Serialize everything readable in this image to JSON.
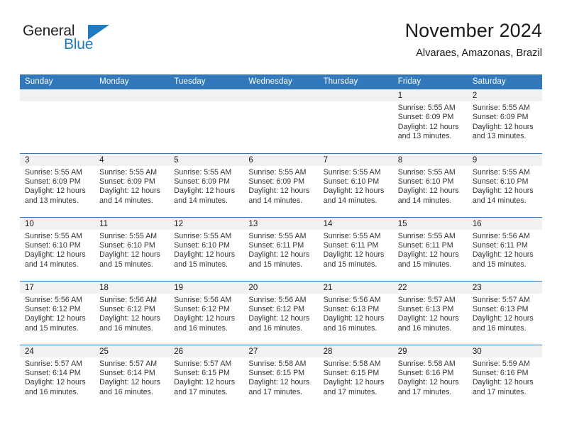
{
  "brand": {
    "name_part1": "General",
    "name_part2": "Blue",
    "triangle_icon": "blue-triangle-icon",
    "accent_color": "#1f7bc1"
  },
  "header": {
    "month_title": "November 2024",
    "location": "Alvaraes, Amazonas, Brazil"
  },
  "theme": {
    "header_blue": "#3279bb",
    "daynum_band": "#f1f1f1",
    "text": "#333333"
  },
  "weekday_headers": [
    "Sunday",
    "Monday",
    "Tuesday",
    "Wednesday",
    "Thursday",
    "Friday",
    "Saturday"
  ],
  "weeks": [
    [
      {
        "day": "",
        "sunrise": "",
        "sunset": "",
        "daylight_line1": "",
        "daylight_line2": "",
        "empty": true
      },
      {
        "day": "",
        "sunrise": "",
        "sunset": "",
        "daylight_line1": "",
        "daylight_line2": "",
        "empty": true
      },
      {
        "day": "",
        "sunrise": "",
        "sunset": "",
        "daylight_line1": "",
        "daylight_line2": "",
        "empty": true
      },
      {
        "day": "",
        "sunrise": "",
        "sunset": "",
        "daylight_line1": "",
        "daylight_line2": "",
        "empty": true
      },
      {
        "day": "",
        "sunrise": "",
        "sunset": "",
        "daylight_line1": "",
        "daylight_line2": "",
        "empty": true
      },
      {
        "day": "1",
        "sunrise": "Sunrise: 5:55 AM",
        "sunset": "Sunset: 6:09 PM",
        "daylight_line1": "Daylight: 12 hours",
        "daylight_line2": "and 13 minutes."
      },
      {
        "day": "2",
        "sunrise": "Sunrise: 5:55 AM",
        "sunset": "Sunset: 6:09 PM",
        "daylight_line1": "Daylight: 12 hours",
        "daylight_line2": "and 13 minutes."
      }
    ],
    [
      {
        "day": "3",
        "sunrise": "Sunrise: 5:55 AM",
        "sunset": "Sunset: 6:09 PM",
        "daylight_line1": "Daylight: 12 hours",
        "daylight_line2": "and 13 minutes."
      },
      {
        "day": "4",
        "sunrise": "Sunrise: 5:55 AM",
        "sunset": "Sunset: 6:09 PM",
        "daylight_line1": "Daylight: 12 hours",
        "daylight_line2": "and 14 minutes."
      },
      {
        "day": "5",
        "sunrise": "Sunrise: 5:55 AM",
        "sunset": "Sunset: 6:09 PM",
        "daylight_line1": "Daylight: 12 hours",
        "daylight_line2": "and 14 minutes."
      },
      {
        "day": "6",
        "sunrise": "Sunrise: 5:55 AM",
        "sunset": "Sunset: 6:09 PM",
        "daylight_line1": "Daylight: 12 hours",
        "daylight_line2": "and 14 minutes."
      },
      {
        "day": "7",
        "sunrise": "Sunrise: 5:55 AM",
        "sunset": "Sunset: 6:10 PM",
        "daylight_line1": "Daylight: 12 hours",
        "daylight_line2": "and 14 minutes."
      },
      {
        "day": "8",
        "sunrise": "Sunrise: 5:55 AM",
        "sunset": "Sunset: 6:10 PM",
        "daylight_line1": "Daylight: 12 hours",
        "daylight_line2": "and 14 minutes."
      },
      {
        "day": "9",
        "sunrise": "Sunrise: 5:55 AM",
        "sunset": "Sunset: 6:10 PM",
        "daylight_line1": "Daylight: 12 hours",
        "daylight_line2": "and 14 minutes."
      }
    ],
    [
      {
        "day": "10",
        "sunrise": "Sunrise: 5:55 AM",
        "sunset": "Sunset: 6:10 PM",
        "daylight_line1": "Daylight: 12 hours",
        "daylight_line2": "and 14 minutes."
      },
      {
        "day": "11",
        "sunrise": "Sunrise: 5:55 AM",
        "sunset": "Sunset: 6:10 PM",
        "daylight_line1": "Daylight: 12 hours",
        "daylight_line2": "and 15 minutes."
      },
      {
        "day": "12",
        "sunrise": "Sunrise: 5:55 AM",
        "sunset": "Sunset: 6:10 PM",
        "daylight_line1": "Daylight: 12 hours",
        "daylight_line2": "and 15 minutes."
      },
      {
        "day": "13",
        "sunrise": "Sunrise: 5:55 AM",
        "sunset": "Sunset: 6:11 PM",
        "daylight_line1": "Daylight: 12 hours",
        "daylight_line2": "and 15 minutes."
      },
      {
        "day": "14",
        "sunrise": "Sunrise: 5:55 AM",
        "sunset": "Sunset: 6:11 PM",
        "daylight_line1": "Daylight: 12 hours",
        "daylight_line2": "and 15 minutes."
      },
      {
        "day": "15",
        "sunrise": "Sunrise: 5:55 AM",
        "sunset": "Sunset: 6:11 PM",
        "daylight_line1": "Daylight: 12 hours",
        "daylight_line2": "and 15 minutes."
      },
      {
        "day": "16",
        "sunrise": "Sunrise: 5:56 AM",
        "sunset": "Sunset: 6:11 PM",
        "daylight_line1": "Daylight: 12 hours",
        "daylight_line2": "and 15 minutes."
      }
    ],
    [
      {
        "day": "17",
        "sunrise": "Sunrise: 5:56 AM",
        "sunset": "Sunset: 6:12 PM",
        "daylight_line1": "Daylight: 12 hours",
        "daylight_line2": "and 15 minutes."
      },
      {
        "day": "18",
        "sunrise": "Sunrise: 5:56 AM",
        "sunset": "Sunset: 6:12 PM",
        "daylight_line1": "Daylight: 12 hours",
        "daylight_line2": "and 16 minutes."
      },
      {
        "day": "19",
        "sunrise": "Sunrise: 5:56 AM",
        "sunset": "Sunset: 6:12 PM",
        "daylight_line1": "Daylight: 12 hours",
        "daylight_line2": "and 16 minutes."
      },
      {
        "day": "20",
        "sunrise": "Sunrise: 5:56 AM",
        "sunset": "Sunset: 6:12 PM",
        "daylight_line1": "Daylight: 12 hours",
        "daylight_line2": "and 16 minutes."
      },
      {
        "day": "21",
        "sunrise": "Sunrise: 5:56 AM",
        "sunset": "Sunset: 6:13 PM",
        "daylight_line1": "Daylight: 12 hours",
        "daylight_line2": "and 16 minutes."
      },
      {
        "day": "22",
        "sunrise": "Sunrise: 5:57 AM",
        "sunset": "Sunset: 6:13 PM",
        "daylight_line1": "Daylight: 12 hours",
        "daylight_line2": "and 16 minutes."
      },
      {
        "day": "23",
        "sunrise": "Sunrise: 5:57 AM",
        "sunset": "Sunset: 6:13 PM",
        "daylight_line1": "Daylight: 12 hours",
        "daylight_line2": "and 16 minutes."
      }
    ],
    [
      {
        "day": "24",
        "sunrise": "Sunrise: 5:57 AM",
        "sunset": "Sunset: 6:14 PM",
        "daylight_line1": "Daylight: 12 hours",
        "daylight_line2": "and 16 minutes."
      },
      {
        "day": "25",
        "sunrise": "Sunrise: 5:57 AM",
        "sunset": "Sunset: 6:14 PM",
        "daylight_line1": "Daylight: 12 hours",
        "daylight_line2": "and 16 minutes."
      },
      {
        "day": "26",
        "sunrise": "Sunrise: 5:57 AM",
        "sunset": "Sunset: 6:15 PM",
        "daylight_line1": "Daylight: 12 hours",
        "daylight_line2": "and 17 minutes."
      },
      {
        "day": "27",
        "sunrise": "Sunrise: 5:58 AM",
        "sunset": "Sunset: 6:15 PM",
        "daylight_line1": "Daylight: 12 hours",
        "daylight_line2": "and 17 minutes."
      },
      {
        "day": "28",
        "sunrise": "Sunrise: 5:58 AM",
        "sunset": "Sunset: 6:15 PM",
        "daylight_line1": "Daylight: 12 hours",
        "daylight_line2": "and 17 minutes."
      },
      {
        "day": "29",
        "sunrise": "Sunrise: 5:58 AM",
        "sunset": "Sunset: 6:16 PM",
        "daylight_line1": "Daylight: 12 hours",
        "daylight_line2": "and 17 minutes."
      },
      {
        "day": "30",
        "sunrise": "Sunrise: 5:59 AM",
        "sunset": "Sunset: 6:16 PM",
        "daylight_line1": "Daylight: 12 hours",
        "daylight_line2": "and 17 minutes."
      }
    ]
  ]
}
